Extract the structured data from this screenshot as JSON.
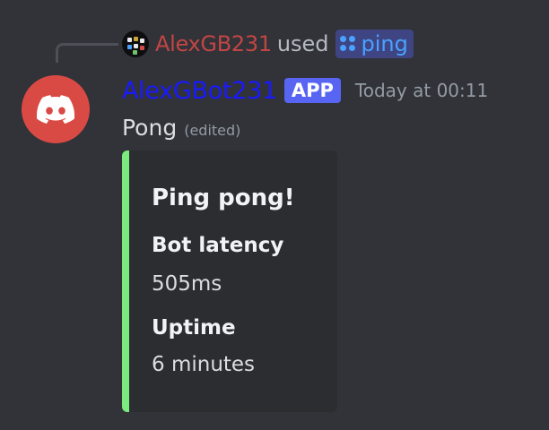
{
  "colors": {
    "background": "#313338",
    "reply_username": "#c24545",
    "bot_username": "#1a1aff",
    "app_badge": "#5865f2",
    "command_pill": "#3e4582",
    "command_text": "#4aa1ff",
    "bot_avatar": "#da4a44",
    "embed_background": "#2b2d31",
    "embed_accent": "#7bea7f"
  },
  "reply": {
    "avatar_icon": "user-avatar-icon",
    "username": "AlexGB231",
    "used_text": "used",
    "command_icon": "slash-command-icon",
    "command": "ping"
  },
  "message": {
    "avatar_icon": "discord-logo-icon",
    "author": "AlexGBot231",
    "badge": "APP",
    "timestamp": "Today at 00:11",
    "content": "Pong",
    "edited": "(edited)"
  },
  "embed": {
    "title": "Ping pong!",
    "fields": [
      {
        "name": "Bot latency",
        "value": "505ms"
      },
      {
        "name": "Uptime",
        "value": "6 minutes"
      }
    ]
  }
}
